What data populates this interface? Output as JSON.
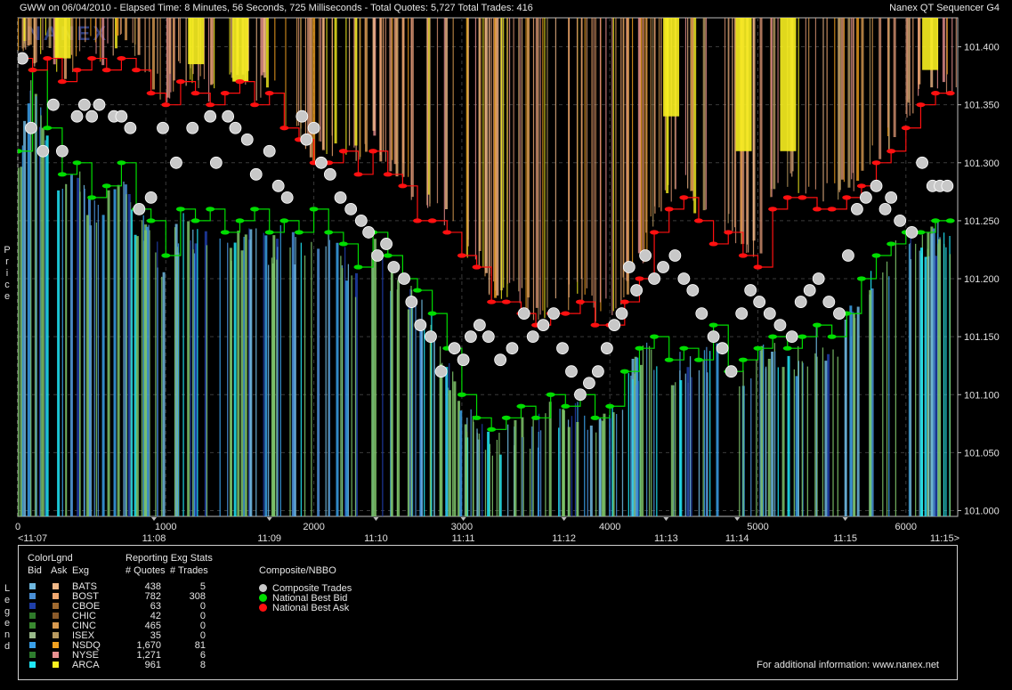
{
  "header": {
    "left": "GWW on 06/04/2010  -  Elapsed Time: 8 Minutes, 56 Seconds, 725 Milliseconds  -  Total Quotes: 5,727  Total Trades: 416",
    "right": "Nanex QT Sequencer G4"
  },
  "watermark": "NANEX",
  "side_labels": {
    "price": "Price",
    "legend": "Legend"
  },
  "chart_data": {
    "type": "line",
    "title": "",
    "ylabel": "Price",
    "xlim": [
      0,
      6350
    ],
    "ylim": [
      100.995,
      101.425
    ],
    "grid": true,
    "x_ticks": [
      {
        "value": 0,
        "label": "0"
      },
      {
        "value": 1000,
        "label": "1000"
      },
      {
        "value": 2000,
        "label": "2000"
      },
      {
        "value": 3000,
        "label": "3000"
      },
      {
        "value": 4000,
        "label": "4000"
      },
      {
        "value": 5000,
        "label": "5000"
      },
      {
        "value": 6000,
        "label": "6000"
      }
    ],
    "time_ticks": [
      {
        "value": 0,
        "label": "<11:07"
      },
      {
        "value": 920,
        "label": "11:08"
      },
      {
        "value": 1700,
        "label": "11:09"
      },
      {
        "value": 2420,
        "label": "11:10"
      },
      {
        "value": 3010,
        "label": "11:11"
      },
      {
        "value": 3690,
        "label": "11:12"
      },
      {
        "value": 4380,
        "label": "11:13"
      },
      {
        "value": 4860,
        "label": "11:14"
      },
      {
        "value": 5590,
        "label": "11:15"
      },
      {
        "value": 6350,
        "label": "11:15>"
      }
    ],
    "y_ticks": [
      {
        "value": 101.0,
        "label": "101.000"
      },
      {
        "value": 101.05,
        "label": "101.050"
      },
      {
        "value": 101.1,
        "label": "101.100"
      },
      {
        "value": 101.15,
        "label": "101.150"
      },
      {
        "value": 101.2,
        "label": "101.200"
      },
      {
        "value": 101.25,
        "label": "101.250"
      },
      {
        "value": 101.3,
        "label": "101.300"
      },
      {
        "value": 101.35,
        "label": "101.350"
      },
      {
        "value": 101.4,
        "label": "101.400"
      }
    ],
    "series": [
      {
        "name": "Composite Trades",
        "color": "#c8c8c8",
        "x": [
          30,
          90,
          170,
          240,
          300,
          400,
          450,
          500,
          550,
          650,
          700,
          760,
          820,
          900,
          980,
          1070,
          1180,
          1300,
          1340,
          1420,
          1470,
          1550,
          1610,
          1700,
          1760,
          1820,
          1920,
          1950,
          2000,
          2050,
          2110,
          2180,
          2250,
          2320,
          2370,
          2430,
          2490,
          2540,
          2610,
          2660,
          2720,
          2790,
          2860,
          2950,
          3010,
          3060,
          3120,
          3180,
          3260,
          3340,
          3420,
          3480,
          3550,
          3620,
          3680,
          3740,
          3800,
          3860,
          3920,
          3980,
          4030,
          4080,
          4130,
          4180,
          4240,
          4300,
          4360,
          4440,
          4500,
          4560,
          4620,
          4700,
          4760,
          4820,
          4890,
          4950,
          5010,
          5080,
          5150,
          5230,
          5290,
          5350,
          5410,
          5480,
          5550,
          5610,
          5670,
          5730,
          5800,
          5860,
          5900,
          5960,
          6040,
          6110,
          6180,
          6230,
          6280
        ],
        "y": [
          101.39,
          101.33,
          101.31,
          101.35,
          101.31,
          101.34,
          101.35,
          101.34,
          101.35,
          101.34,
          101.34,
          101.33,
          101.26,
          101.27,
          101.33,
          101.3,
          101.33,
          101.34,
          101.3,
          101.34,
          101.33,
          101.32,
          101.29,
          101.31,
          101.28,
          101.27,
          101.34,
          101.32,
          101.33,
          101.3,
          101.29,
          101.27,
          101.26,
          101.25,
          101.24,
          101.22,
          101.23,
          101.21,
          101.2,
          101.18,
          101.16,
          101.15,
          101.12,
          101.14,
          101.13,
          101.15,
          101.16,
          101.15,
          101.13,
          101.14,
          101.17,
          101.15,
          101.16,
          101.17,
          101.14,
          101.12,
          101.1,
          101.11,
          101.12,
          101.14,
          101.16,
          101.17,
          101.21,
          101.19,
          101.22,
          101.2,
          101.21,
          101.22,
          101.2,
          101.19,
          101.17,
          101.15,
          101.14,
          101.12,
          101.17,
          101.19,
          101.18,
          101.17,
          101.16,
          101.15,
          101.18,
          101.19,
          101.2,
          101.18,
          101.17,
          101.22,
          101.26,
          101.27,
          101.28,
          101.26,
          101.27,
          101.25,
          101.24,
          101.3,
          101.28,
          101.28,
          101.28
        ]
      },
      {
        "name": "National Best Bid",
        "color": "#00dd00",
        "x": [
          0,
          100,
          200,
          300,
          400,
          500,
          600,
          700,
          800,
          900,
          1000,
          1100,
          1200,
          1300,
          1400,
          1500,
          1600,
          1700,
          1800,
          1900,
          2000,
          2100,
          2200,
          2300,
          2400,
          2500,
          2600,
          2700,
          2800,
          2900,
          3000,
          3100,
          3200,
          3300,
          3400,
          3500,
          3600,
          3700,
          3800,
          3900,
          4000,
          4100,
          4200,
          4300,
          4400,
          4500,
          4600,
          4700,
          4800,
          4900,
          5000,
          5100,
          5200,
          5300,
          5400,
          5500,
          5600,
          5700,
          5800,
          5900,
          6000,
          6100,
          6200,
          6300
        ],
        "y": [
          101.31,
          101.38,
          101.33,
          101.29,
          101.3,
          101.27,
          101.28,
          101.3,
          101.26,
          101.25,
          101.22,
          101.26,
          101.25,
          101.26,
          101.24,
          101.25,
          101.26,
          101.24,
          101.25,
          101.24,
          101.26,
          101.24,
          101.23,
          101.21,
          101.24,
          101.22,
          101.2,
          101.19,
          101.17,
          101.14,
          101.1,
          101.08,
          101.07,
          101.08,
          101.09,
          101.08,
          101.1,
          101.09,
          101.1,
          101.08,
          101.09,
          101.12,
          101.14,
          101.15,
          101.13,
          101.14,
          101.13,
          101.16,
          101.12,
          101.13,
          101.14,
          101.15,
          101.14,
          101.15,
          101.16,
          101.15,
          101.17,
          101.2,
          101.22,
          101.23,
          101.24,
          101.24,
          101.25,
          101.25
        ]
      },
      {
        "name": "National Best Ask",
        "color": "#ff1010",
        "x": [
          0,
          100,
          200,
          300,
          400,
          500,
          600,
          700,
          800,
          900,
          1000,
          1100,
          1200,
          1300,
          1400,
          1500,
          1600,
          1700,
          1800,
          1900,
          2000,
          2100,
          2200,
          2300,
          2400,
          2500,
          2600,
          2700,
          2800,
          2900,
          3000,
          3100,
          3200,
          3300,
          3400,
          3500,
          3600,
          3700,
          3800,
          3900,
          4000,
          4100,
          4200,
          4300,
          4400,
          4500,
          4600,
          4700,
          4800,
          4900,
          5000,
          5100,
          5200,
          5300,
          5400,
          5500,
          5600,
          5700,
          5800,
          5900,
          6000,
          6100,
          6200,
          6300
        ],
        "y": [
          101.39,
          101.38,
          101.39,
          101.37,
          101.38,
          101.39,
          101.38,
          101.39,
          101.38,
          101.36,
          101.35,
          101.37,
          101.36,
          101.35,
          101.36,
          101.37,
          101.35,
          101.36,
          101.33,
          101.32,
          101.3,
          101.3,
          101.31,
          101.29,
          101.31,
          101.29,
          101.28,
          101.25,
          101.25,
          101.24,
          101.22,
          101.21,
          101.18,
          101.18,
          101.17,
          101.16,
          101.17,
          101.17,
          101.18,
          101.16,
          101.16,
          101.18,
          101.2,
          101.24,
          101.26,
          101.27,
          101.25,
          101.23,
          101.24,
          101.22,
          101.21,
          101.26,
          101.27,
          101.27,
          101.26,
          101.26,
          101.27,
          101.28,
          101.3,
          101.31,
          101.33,
          101.35,
          101.36,
          101.36
        ]
      }
    ]
  },
  "legend": {
    "title": "ColorLgnd",
    "col_bid": "Bid",
    "col_ask": "Ask",
    "col_exg": "Exg",
    "stats_title": "Reporting Exg Stats",
    "col_quotes": "# Quotes",
    "col_trades": "# Trades",
    "composite_title": "Composite/NBBO",
    "composite_items": [
      {
        "label": "Composite Trades",
        "color": "#c8c8c8"
      },
      {
        "label": "National Best Bid",
        "color": "#00dd00"
      },
      {
        "label": "National Best Ask",
        "color": "#ff1010"
      }
    ],
    "exchanges": [
      {
        "name": "BATS",
        "quotes": "438",
        "trades": "5",
        "bid_color": "#6fb8e0",
        "ask_color": "#f0b888"
      },
      {
        "name": "BOST",
        "quotes": "782",
        "trades": "308",
        "bid_color": "#4a8fd6",
        "ask_color": "#f0a870"
      },
      {
        "name": "CBOE",
        "quotes": "63",
        "trades": "0",
        "bid_color": "#1f3ea8",
        "ask_color": "#a06a30"
      },
      {
        "name": "CHIC",
        "quotes": "42",
        "trades": "0",
        "bid_color": "#2f7a2a",
        "ask_color": "#8a5a2a"
      },
      {
        "name": "CINC",
        "quotes": "465",
        "trades": "0",
        "bid_color": "#3a8a30",
        "ask_color": "#d89a50"
      },
      {
        "name": "ISEX",
        "quotes": "35",
        "trades": "0",
        "bid_color": "#9aba8a",
        "ask_color": "#b89a60"
      },
      {
        "name": "NSDQ",
        "quotes": "1,670",
        "trades": "81",
        "bid_color": "#3aa0e8",
        "ask_color": "#f0a020"
      },
      {
        "name": "NYSE",
        "quotes": "1,271",
        "trades": "6",
        "bid_color": "#2e7d2e",
        "ask_color": "#e89090"
      },
      {
        "name": "ARCA",
        "quotes": "961",
        "trades": "8",
        "bid_color": "#20e8f8",
        "ask_color": "#f8f020"
      }
    ],
    "footer": "For additional information: www.nanex.net"
  }
}
